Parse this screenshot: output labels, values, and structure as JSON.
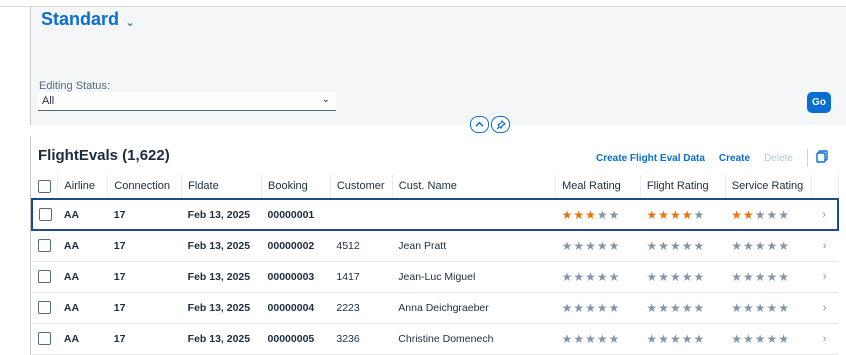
{
  "variant": {
    "title": "Standard",
    "chevron": "⌄"
  },
  "filter": {
    "label": "Editing Status:",
    "value": "All",
    "caret": "⌄"
  },
  "go_label": "Go",
  "toggles": {
    "collapse": "⌃",
    "pin": "📌"
  },
  "table": {
    "title": "FlightEvals (1,622)",
    "actions": {
      "create_data": "Create Flight Eval Data",
      "create": "Create",
      "delete": "Delete"
    },
    "columns": [
      "Airline",
      "Connection",
      "Fldate",
      "Booking",
      "Customer",
      "Cust. Name",
      "Meal Rating",
      "Flight Rating",
      "Service Rating"
    ],
    "rows": [
      {
        "airline": "AA",
        "connection": "17",
        "fldate": "Feb 13, 2025",
        "booking": "00000001",
        "customer": "",
        "name": "",
        "meal": 3,
        "flight": 4,
        "service": 2
      },
      {
        "airline": "AA",
        "connection": "17",
        "fldate": "Feb 13, 2025",
        "booking": "00000002",
        "customer": "4512",
        "name": "Jean Pratt",
        "meal": 0,
        "flight": 0,
        "service": 0
      },
      {
        "airline": "AA",
        "connection": "17",
        "fldate": "Feb 13, 2025",
        "booking": "00000003",
        "customer": "1417",
        "name": "Jean-Luc Miguel",
        "meal": 0,
        "flight": 0,
        "service": 0
      },
      {
        "airline": "AA",
        "connection": "17",
        "fldate": "Feb 13, 2025",
        "booking": "00000004",
        "customer": "2223",
        "name": "Anna Deichgraeber",
        "meal": 0,
        "flight": 0,
        "service": 0
      },
      {
        "airline": "AA",
        "connection": "17",
        "fldate": "Feb 13, 2025",
        "booking": "00000005",
        "customer": "3236",
        "name": "Christine Domenech",
        "meal": 0,
        "flight": 0,
        "service": 0
      }
    ],
    "max_stars": 5
  },
  "colors": {
    "accent": "#0a6ed1",
    "star_on": "#e9730c",
    "star_off": "#8396a8"
  },
  "icons": [
    "chevron-down-icon",
    "collapse-icon",
    "pin-icon",
    "copy-icon",
    "row-nav-icon"
  ]
}
